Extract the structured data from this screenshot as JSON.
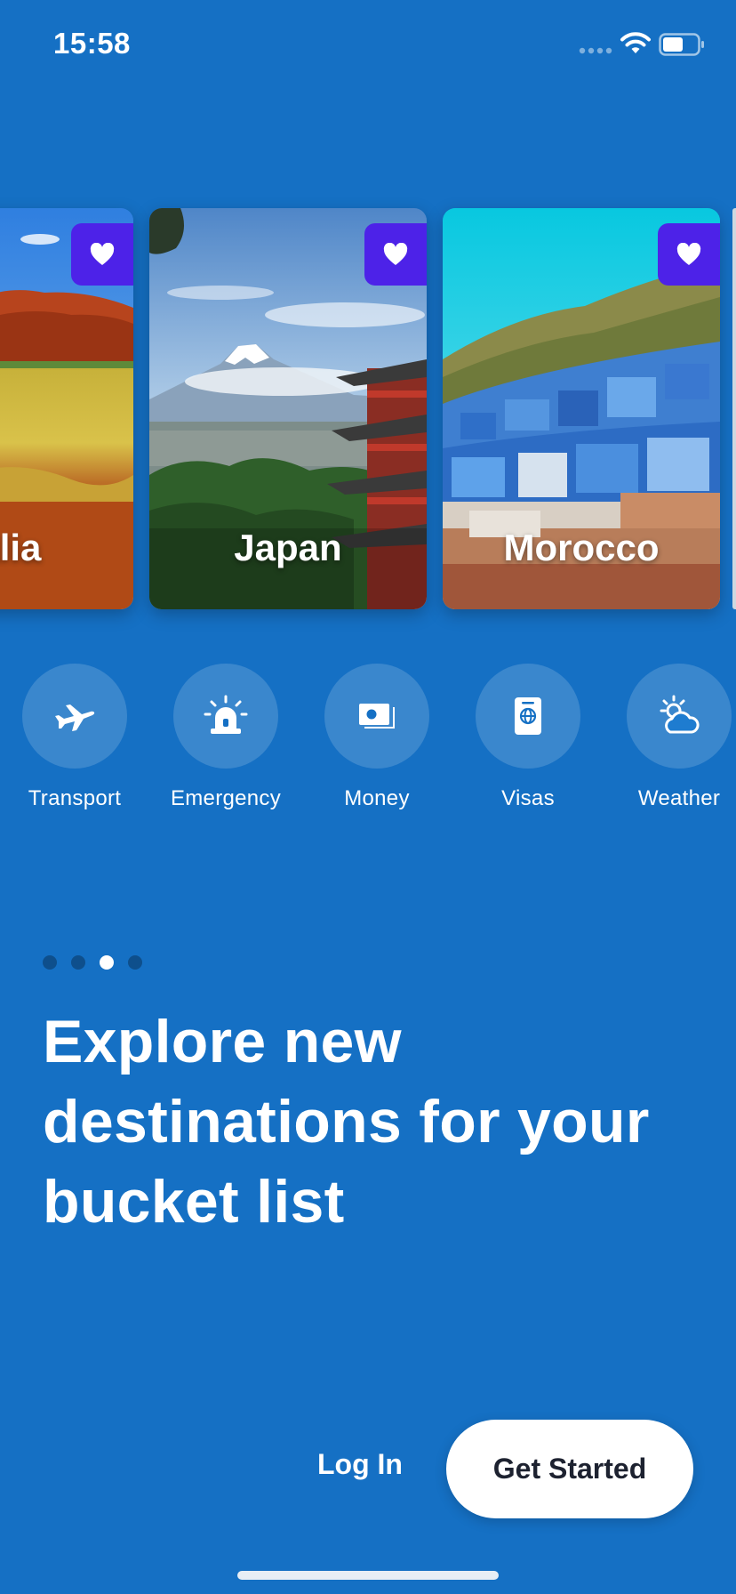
{
  "status_bar": {
    "time": "15:58",
    "icons": [
      "signal-icon",
      "wifi-icon",
      "battery-icon"
    ]
  },
  "destinations": [
    {
      "name": "ralia",
      "favorite": true,
      "icon": "heart-icon"
    },
    {
      "name": "Japan",
      "favorite": true,
      "icon": "heart-icon"
    },
    {
      "name": "Morocco",
      "favorite": true,
      "icon": "heart-icon"
    }
  ],
  "categories": [
    {
      "label": "Transport",
      "icon": "airplane-icon"
    },
    {
      "label": "Emergency",
      "icon": "siren-icon"
    },
    {
      "label": "Money",
      "icon": "money-icon"
    },
    {
      "label": "Visas",
      "icon": "passport-icon"
    },
    {
      "label": "Weather",
      "icon": "partly-cloudy-icon"
    }
  ],
  "onboarding": {
    "page_count": 4,
    "active_page": 3,
    "headline": "Explore new destinations for your bucket list"
  },
  "actions": {
    "login_label": "Log In",
    "get_started_label": "Get Started"
  },
  "colors": {
    "background": "#1570c4",
    "favorite_badge": "#4d22e8",
    "primary_button_bg": "#ffffff",
    "primary_button_text": "#1d2230"
  }
}
